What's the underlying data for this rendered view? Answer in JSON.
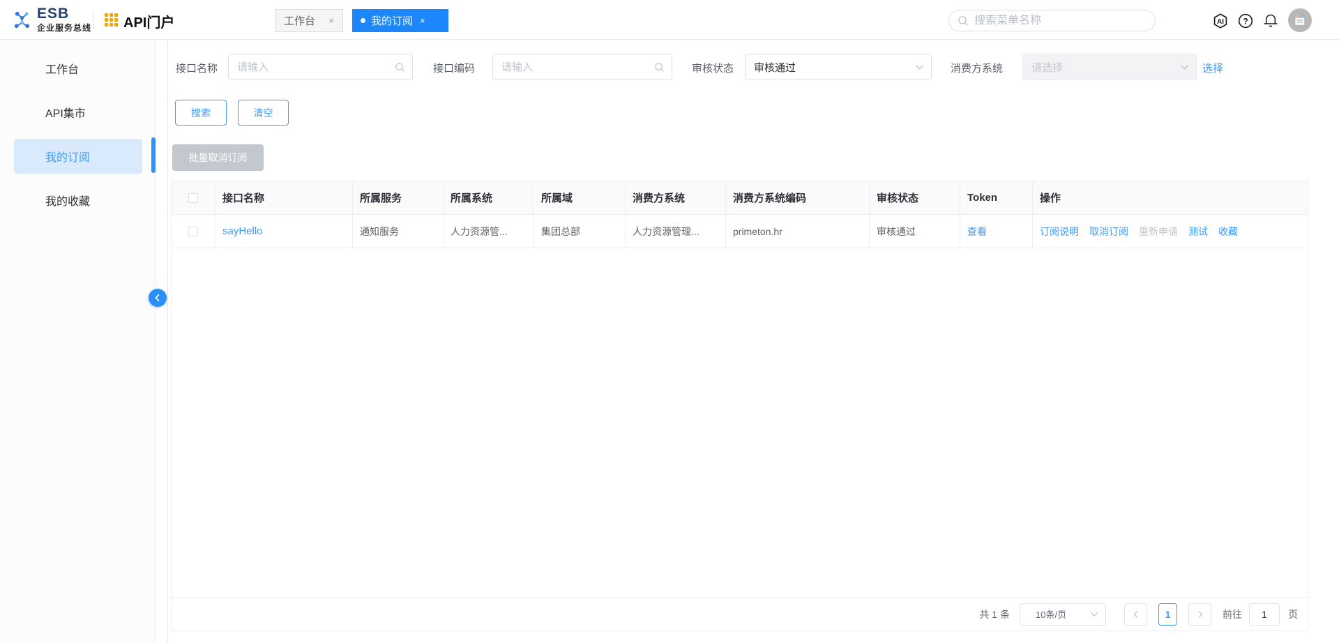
{
  "colors": {
    "accent": "#1b87fa",
    "link": "#3a9afc",
    "disabled_text": "#c0c4cc",
    "brand_orange": "#f5a300",
    "logo_blue": "#2e7be5"
  },
  "header": {
    "logo_title": "ESB",
    "logo_subtitle": "企业服务总线",
    "portal_title": "API门户",
    "tabs": [
      {
        "label": "工作台",
        "close": "×",
        "active": false
      },
      {
        "label": "我的订阅",
        "close": "×",
        "active": true
      }
    ],
    "search_placeholder": "搜索菜单名称",
    "icons": [
      "ai-assistant-icon",
      "help-icon",
      "bell-icon",
      "user-avatar"
    ]
  },
  "sidebar": {
    "items": [
      {
        "label": "工作台",
        "active": false
      },
      {
        "label": "API集市",
        "active": false
      },
      {
        "label": "我的订阅",
        "active": true
      },
      {
        "label": "我的收藏",
        "active": false
      }
    ]
  },
  "filters": {
    "interface_name": {
      "label": "接口名称",
      "placeholder": "请输入"
    },
    "interface_code": {
      "label": "接口编码",
      "placeholder": "请输入"
    },
    "audit_status": {
      "label": "审核状态",
      "value": "审核通过"
    },
    "consumer_system": {
      "label": "消费方系统",
      "placeholder": "请选择",
      "select_link": "选择"
    }
  },
  "buttons": {
    "search": "搜索",
    "clear": "清空",
    "batch_cancel": "批量取消订阅"
  },
  "table": {
    "columns": [
      "接口名称",
      "所属服务",
      "所属系统",
      "所属域",
      "消费方系统",
      "消费方系统编码",
      "审核状态",
      "Token",
      "操作"
    ],
    "rows": [
      {
        "name": "sayHello",
        "service": "通知服务",
        "system": "人力资源管...",
        "domain": "集团总部",
        "consumer": "人力资源管理...",
        "consumer_code": "primeton.hr",
        "status": "审核通过",
        "token_action": "查看",
        "ops": [
          {
            "label": "订阅说明",
            "disabled": false
          },
          {
            "label": "取消订阅",
            "disabled": false
          },
          {
            "label": "重新申请",
            "disabled": true
          },
          {
            "label": "测试",
            "disabled": false
          },
          {
            "label": "收藏",
            "disabled": false
          }
        ]
      }
    ]
  },
  "pagination": {
    "total": "共 1 条",
    "page_size": "10条/页",
    "current_page": "1",
    "goto_label": "前往",
    "goto_value": "1",
    "page_unit": "页"
  }
}
